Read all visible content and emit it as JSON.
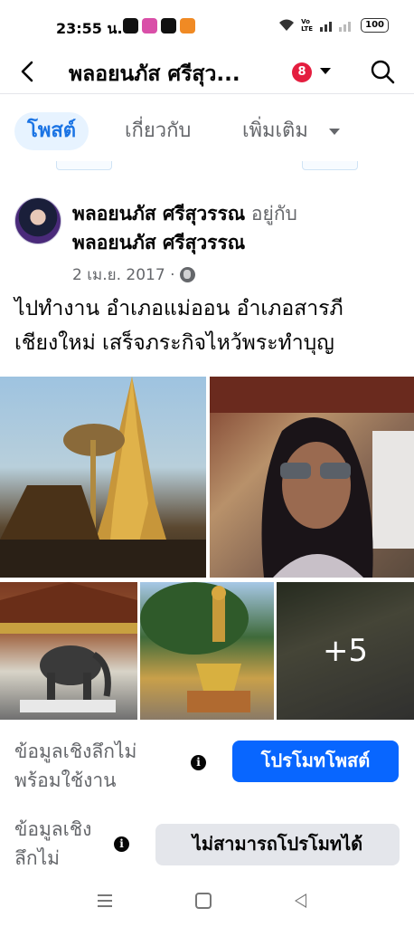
{
  "status_bar": {
    "time": "23:55 น.",
    "battery": "100",
    "network": "Vo LTE"
  },
  "header": {
    "title": "พลอยนภัส ศรีสุว...",
    "notification_count": "8",
    "icons": [
      "back-arrow-icon",
      "chevron-down-icon",
      "search-icon"
    ]
  },
  "tabs": {
    "posts": "โพสต์",
    "about": "เกี่ยวกับ",
    "more": "เพิ่มเติม"
  },
  "post": {
    "author": "พลอยนภัส ศรีสุวรรณ",
    "with_text": "อยู่กับ",
    "tagged": "พลอยนภัส ศรีสุวรรณ",
    "date": "2 เม.ย. 2017 ·",
    "privacy_icon": "globe-icon",
    "text_line_1": "ไปทำงาน อำเภอแม่ออน  อำเภอสารภี",
    "text_line_2": "เชียงใหม่  เสร็จภระกิจไหว้พระทำบุญ",
    "more_photos": "+5"
  },
  "promo": {
    "insight_1_line_1": "ข้อมูลเชิงลึกไม่",
    "insight_1_line_2": "พร้อมใช้งาน",
    "promote_label": "โปรโมทโพสต์",
    "insight_2_line_1": "ข้อมูลเชิง",
    "insight_2_line_2": "ลึกไม่",
    "cannot_promote_label": "ไม่สามารถโปรโมทได้",
    "info_glyph": "i"
  },
  "colors": {
    "accent": "#0866ff",
    "tab_active_bg": "#e7f3ff",
    "badge": "#e41e3f"
  }
}
